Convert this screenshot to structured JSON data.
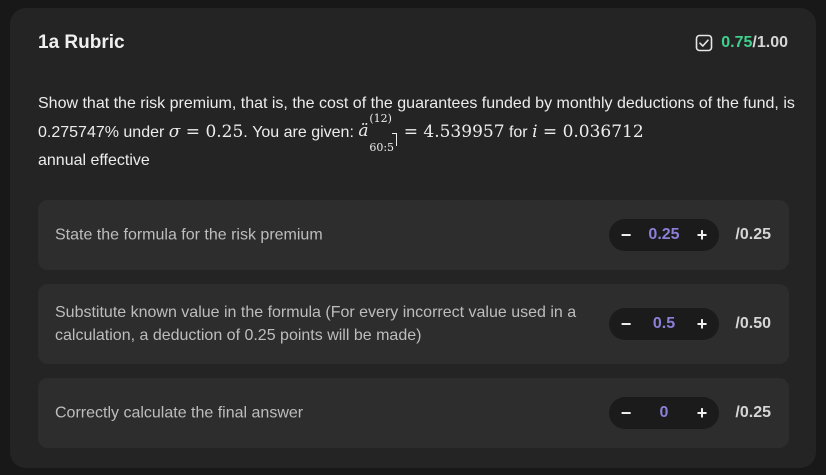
{
  "header": {
    "title": "1a Rubric",
    "score_got": "0.75",
    "score_total": "/1.00",
    "icon": "checkbox-checked-icon"
  },
  "question": {
    "part1": "Show that the risk premium, that is, the cost of the guarantees funded by monthly deductions of the fund, is 0.275747% under ",
    "sigma": "σ",
    "eq1": " = 0.25",
    "part2": ". You are given: ",
    "annuity_base": "ä",
    "annuity_sup": "(12)",
    "annuity_sub": "60:5",
    "eq2": " = 4.539957",
    "part3": " for ",
    "i_var": "i",
    "eq3": " = 0.036712",
    "part4": " annual effective"
  },
  "criteria": [
    {
      "label": "State the formula for the risk premium",
      "value": "0.25",
      "max": "/0.25"
    },
    {
      "label": "Substitute known value in the formula (For every incorrect value used in a calculation, a deduction of 0.25 points will be made)",
      "value": "0.5",
      "max": "/0.50"
    },
    {
      "label": "Correctly calculate the final answer",
      "value": "0",
      "max": "/0.25"
    }
  ],
  "controls": {
    "minus": "−",
    "plus": "+"
  },
  "colors": {
    "accent_green": "#3fcf8e",
    "accent_purple": "#8b7fd8",
    "card_bg": "#242424",
    "row_bg": "#2d2d2d"
  }
}
